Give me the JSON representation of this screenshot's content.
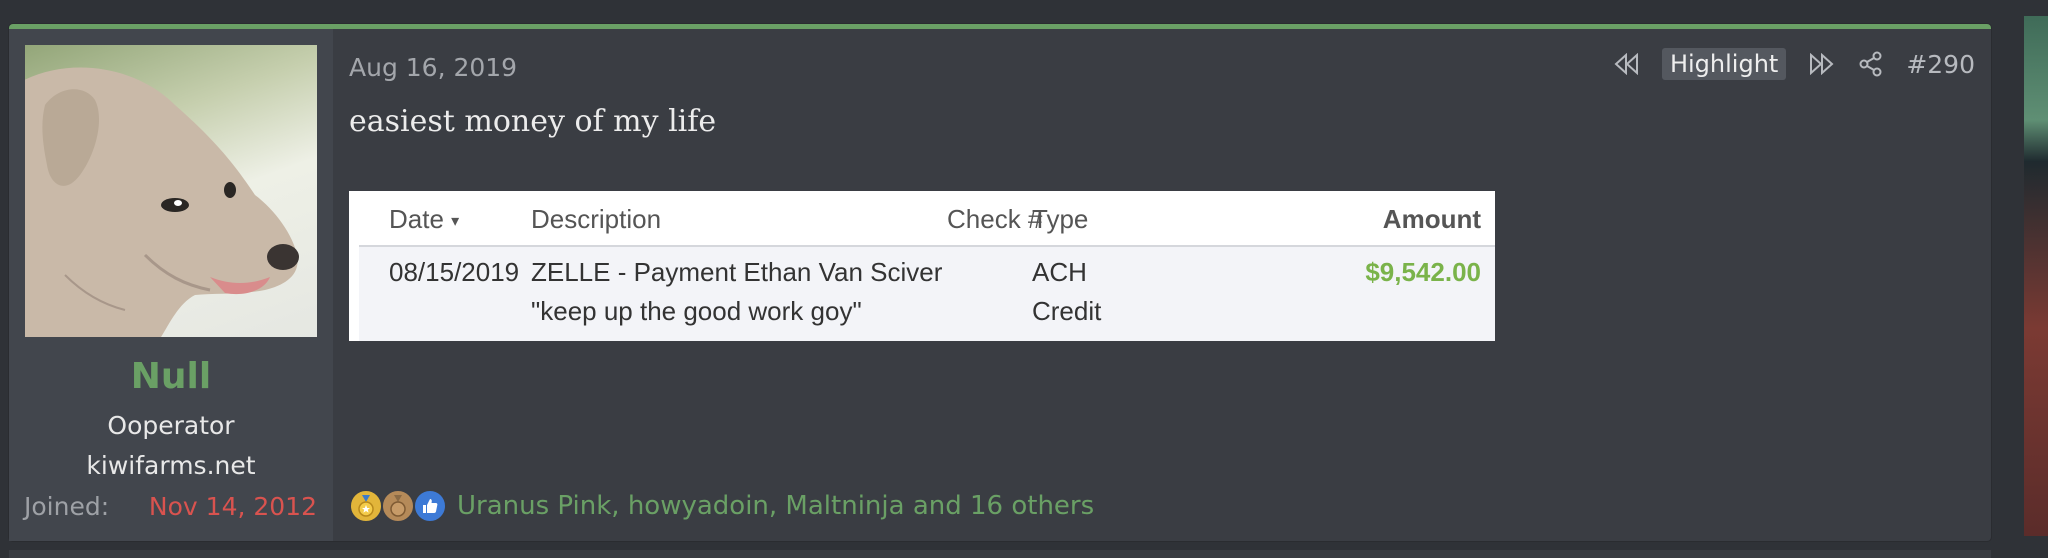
{
  "post": {
    "date": "Aug 16, 2019",
    "message": "easiest money of my life",
    "actions": {
      "highlight_label": "Highlight",
      "post_number": "#290"
    },
    "reactions": {
      "text": "Uranus Pink, howyadoin, Maltninja and 16 others",
      "icons": [
        "gold-medal-icon",
        "bronze-medal-icon",
        "thumbs-up-icon"
      ]
    }
  },
  "user": {
    "name": "Null",
    "title": "Ooperator",
    "site": "kiwifarms.net",
    "joined_label": "Joined:",
    "joined_value": "Nov 14, 2012"
  },
  "transaction": {
    "headers": {
      "date": "Date",
      "description": "Description",
      "check": "Check #",
      "type": "Type",
      "amount": "Amount"
    },
    "row": {
      "date": "08/15/2019",
      "description_line1": "ZELLE - Payment Ethan Van Sciver",
      "description_line2": "\"keep up the good work goy\"",
      "type_line1": "ACH",
      "type_line2": "Credit",
      "amount": "$9,542.00"
    }
  },
  "colors": {
    "accent_green": "#6aa065",
    "joined_red": "#d9534f",
    "amount_green": "#7ab34a"
  }
}
